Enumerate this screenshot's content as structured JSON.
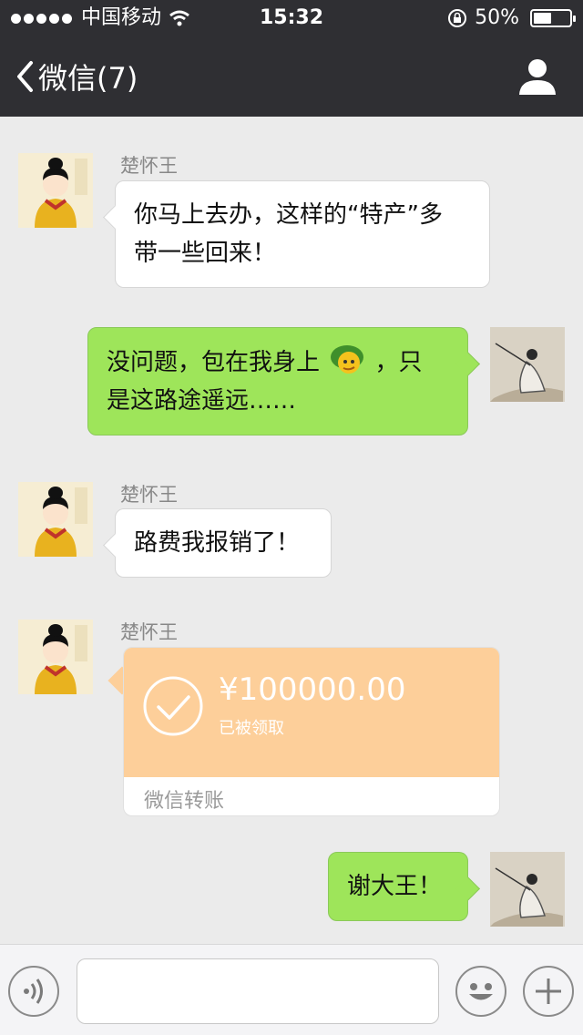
{
  "status_bar": {
    "carrier": "中国移动",
    "time": "15:32",
    "battery": "50%",
    "battery_level": 0.5
  },
  "nav": {
    "back_label": "微信(7)"
  },
  "messages": [
    {
      "side": "left",
      "sender": "楚怀王",
      "line1": "你马上去办，这样的“特产”多",
      "line2": "带一些回来！"
    },
    {
      "side": "right",
      "line1": "没问题，包在我身上",
      "line1_tail": "，只",
      "line2": "是这路途遥远……"
    },
    {
      "side": "left",
      "sender": "楚怀王",
      "line1": "路费我报销了！"
    },
    {
      "side": "left",
      "sender": "楚怀王",
      "type": "transfer",
      "amount": "¥100000.00",
      "status": "已被领取",
      "label": "微信转账"
    },
    {
      "side": "right",
      "line1": "谢大王！"
    }
  ],
  "colors": {
    "nav_bg": "#2f2f33",
    "chat_bg": "#ebebeb",
    "bubble_green": "#9ee55a",
    "transfer_orange": "#fdcf9a"
  },
  "icons": {
    "back": "chevron-left-icon",
    "profile": "person-icon",
    "voice": "voice-icon",
    "emoji": "emoji-icon",
    "plus": "plus-icon",
    "transfer_check": "check-circle-icon",
    "sticker": "turtle-emoji-icon"
  }
}
